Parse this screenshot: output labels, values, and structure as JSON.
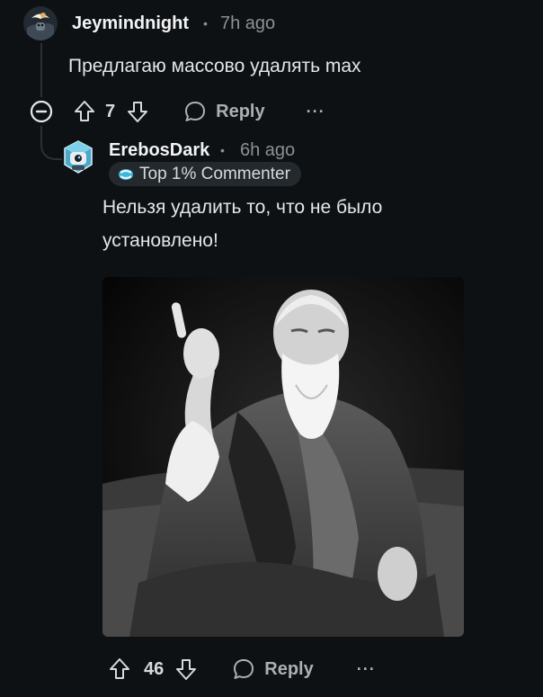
{
  "parent_comment": {
    "username": "Jeymindnight",
    "separator": "•",
    "time_ago": "7h ago",
    "text": "Предлагаю массово удалять max",
    "upvote_count": "7",
    "reply_label": "Reply",
    "more_label": "···"
  },
  "reply_comment": {
    "username": "ErebosDark",
    "separator": "•",
    "time_ago": "6h ago",
    "badge": "Top 1% Commenter",
    "text_line_1": "Нельзя удалить то, что не было",
    "text_line_2": "установлено!",
    "upvote_count": "46",
    "reply_label": "Reply",
    "more_label": "···"
  },
  "colors": {
    "background": "#0e1113",
    "text": "#d7dadc",
    "muted": "#8b9194",
    "badge_bg": "#23292d"
  }
}
